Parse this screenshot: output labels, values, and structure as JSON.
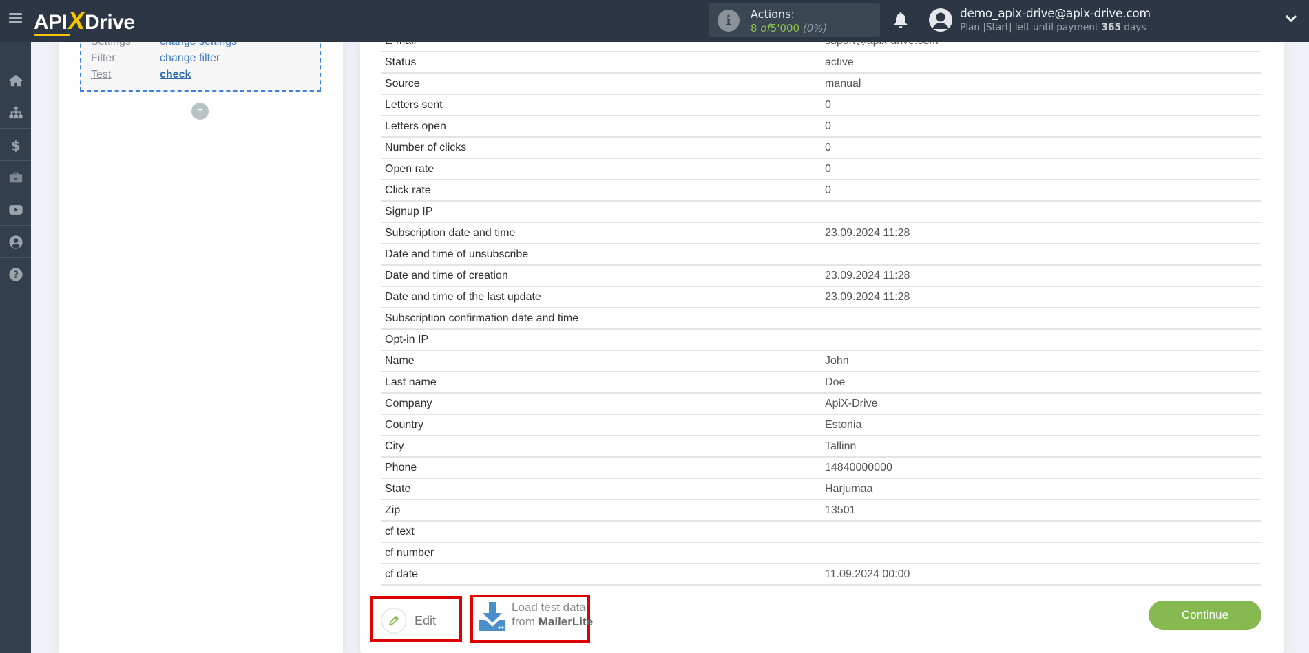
{
  "header": {
    "logo": {
      "part1": "API",
      "part2": "X",
      "part3": "Drive"
    },
    "actions": {
      "label": "Actions:",
      "used": "8",
      "of_word": "of",
      "total": "5'000",
      "percent": "(0%)"
    },
    "user": {
      "email": "demo_apix-drive@apix-drive.com",
      "plan_prefix": "Plan |Start| left until payment",
      "days_number": "365",
      "days_word": "days"
    },
    "colors": {
      "topbar": "#2c3644",
      "accent_yellow": "#f5c400",
      "actions_green": "#8bc34a"
    }
  },
  "sidebar": {
    "items": [
      {
        "name": "home",
        "icon": "home-icon"
      },
      {
        "name": "connections",
        "icon": "sitemap-icon"
      },
      {
        "name": "billing",
        "icon": "dollar-icon"
      },
      {
        "name": "briefcase",
        "icon": "briefcase-icon"
      },
      {
        "name": "video",
        "icon": "youtube-icon"
      },
      {
        "name": "account",
        "icon": "user-circle-icon"
      },
      {
        "name": "help",
        "icon": "question-icon"
      }
    ]
  },
  "left_panel": {
    "steps": [
      {
        "label": "Settings",
        "value": "change settings"
      },
      {
        "label": "Filter",
        "value": "change filter"
      },
      {
        "label": "Test",
        "value": "check"
      }
    ],
    "add_label": "+"
  },
  "main": {
    "rows": [
      {
        "key": "E-mail",
        "value": "suport@apix-drive.com"
      },
      {
        "key": "Status",
        "value": "active"
      },
      {
        "key": "Source",
        "value": "manual"
      },
      {
        "key": "Letters sent",
        "value": "0"
      },
      {
        "key": "Letters open",
        "value": "0"
      },
      {
        "key": "Number of clicks",
        "value": "0"
      },
      {
        "key": "Open rate",
        "value": "0"
      },
      {
        "key": "Click rate",
        "value": "0"
      },
      {
        "key": "Signup IP",
        "value": ""
      },
      {
        "key": "Subscription date and time",
        "value": "23.09.2024 11:28"
      },
      {
        "key": "Date and time of unsubscribe",
        "value": ""
      },
      {
        "key": "Date and time of creation",
        "value": "23.09.2024 11:28"
      },
      {
        "key": "Date and time of the last update",
        "value": "23.09.2024 11:28"
      },
      {
        "key": "Subscription confirmation date and time",
        "value": ""
      },
      {
        "key": "Opt-in IP",
        "value": ""
      },
      {
        "key": "Name",
        "value": "John"
      },
      {
        "key": "Last name",
        "value": "Doe"
      },
      {
        "key": "Company",
        "value": "ApiX-Drive"
      },
      {
        "key": "Country",
        "value": "Estonia"
      },
      {
        "key": "City",
        "value": "Tallinn"
      },
      {
        "key": "Phone",
        "value": "14840000000"
      },
      {
        "key": "State",
        "value": "Harjumaa"
      },
      {
        "key": "Zip",
        "value": "13501"
      },
      {
        "key": "cf text",
        "value": ""
      },
      {
        "key": "cf number",
        "value": ""
      },
      {
        "key": "cf date",
        "value": "11.09.2024 00:00"
      }
    ],
    "edit_label": "Edit",
    "load": {
      "line1": "Load test data",
      "line2_prefix": "from",
      "service": "MailerLite"
    },
    "continue_label": "Continue",
    "colors": {
      "continue": "#86b94f",
      "highlight": "#e00000",
      "load_icon": "#4a8fc9"
    }
  }
}
